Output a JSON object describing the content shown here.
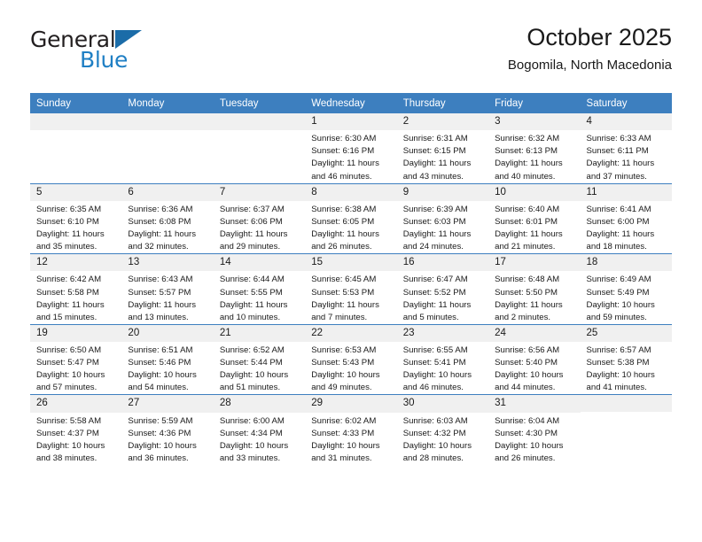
{
  "brand": {
    "name_top": "General",
    "name_bottom": "Blue",
    "accent_color": "#1f7fc4",
    "triangle_color": "#1b6ca8"
  },
  "header": {
    "title": "October 2025",
    "subtitle": "Bogomila, North Macedonia"
  },
  "colors": {
    "header_row": "#3d7fbf",
    "daynum_band": "#f0f0f0",
    "cell_background": "#ffffff",
    "text": "#1a1a1a"
  },
  "weekdays": [
    "Sunday",
    "Monday",
    "Tuesday",
    "Wednesday",
    "Thursday",
    "Friday",
    "Saturday"
  ],
  "weeks": [
    [
      {
        "day": "",
        "sunrise": "",
        "sunset": "",
        "daylight1": "",
        "daylight2": ""
      },
      {
        "day": "",
        "sunrise": "",
        "sunset": "",
        "daylight1": "",
        "daylight2": ""
      },
      {
        "day": "",
        "sunrise": "",
        "sunset": "",
        "daylight1": "",
        "daylight2": ""
      },
      {
        "day": "1",
        "sunrise": "Sunrise: 6:30 AM",
        "sunset": "Sunset: 6:16 PM",
        "daylight1": "Daylight: 11 hours",
        "daylight2": "and 46 minutes."
      },
      {
        "day": "2",
        "sunrise": "Sunrise: 6:31 AM",
        "sunset": "Sunset: 6:15 PM",
        "daylight1": "Daylight: 11 hours",
        "daylight2": "and 43 minutes."
      },
      {
        "day": "3",
        "sunrise": "Sunrise: 6:32 AM",
        "sunset": "Sunset: 6:13 PM",
        "daylight1": "Daylight: 11 hours",
        "daylight2": "and 40 minutes."
      },
      {
        "day": "4",
        "sunrise": "Sunrise: 6:33 AM",
        "sunset": "Sunset: 6:11 PM",
        "daylight1": "Daylight: 11 hours",
        "daylight2": "and 37 minutes."
      }
    ],
    [
      {
        "day": "5",
        "sunrise": "Sunrise: 6:35 AM",
        "sunset": "Sunset: 6:10 PM",
        "daylight1": "Daylight: 11 hours",
        "daylight2": "and 35 minutes."
      },
      {
        "day": "6",
        "sunrise": "Sunrise: 6:36 AM",
        "sunset": "Sunset: 6:08 PM",
        "daylight1": "Daylight: 11 hours",
        "daylight2": "and 32 minutes."
      },
      {
        "day": "7",
        "sunrise": "Sunrise: 6:37 AM",
        "sunset": "Sunset: 6:06 PM",
        "daylight1": "Daylight: 11 hours",
        "daylight2": "and 29 minutes."
      },
      {
        "day": "8",
        "sunrise": "Sunrise: 6:38 AM",
        "sunset": "Sunset: 6:05 PM",
        "daylight1": "Daylight: 11 hours",
        "daylight2": "and 26 minutes."
      },
      {
        "day": "9",
        "sunrise": "Sunrise: 6:39 AM",
        "sunset": "Sunset: 6:03 PM",
        "daylight1": "Daylight: 11 hours",
        "daylight2": "and 24 minutes."
      },
      {
        "day": "10",
        "sunrise": "Sunrise: 6:40 AM",
        "sunset": "Sunset: 6:01 PM",
        "daylight1": "Daylight: 11 hours",
        "daylight2": "and 21 minutes."
      },
      {
        "day": "11",
        "sunrise": "Sunrise: 6:41 AM",
        "sunset": "Sunset: 6:00 PM",
        "daylight1": "Daylight: 11 hours",
        "daylight2": "and 18 minutes."
      }
    ],
    [
      {
        "day": "12",
        "sunrise": "Sunrise: 6:42 AM",
        "sunset": "Sunset: 5:58 PM",
        "daylight1": "Daylight: 11 hours",
        "daylight2": "and 15 minutes."
      },
      {
        "day": "13",
        "sunrise": "Sunrise: 6:43 AM",
        "sunset": "Sunset: 5:57 PM",
        "daylight1": "Daylight: 11 hours",
        "daylight2": "and 13 minutes."
      },
      {
        "day": "14",
        "sunrise": "Sunrise: 6:44 AM",
        "sunset": "Sunset: 5:55 PM",
        "daylight1": "Daylight: 11 hours",
        "daylight2": "and 10 minutes."
      },
      {
        "day": "15",
        "sunrise": "Sunrise: 6:45 AM",
        "sunset": "Sunset: 5:53 PM",
        "daylight1": "Daylight: 11 hours",
        "daylight2": "and 7 minutes."
      },
      {
        "day": "16",
        "sunrise": "Sunrise: 6:47 AM",
        "sunset": "Sunset: 5:52 PM",
        "daylight1": "Daylight: 11 hours",
        "daylight2": "and 5 minutes."
      },
      {
        "day": "17",
        "sunrise": "Sunrise: 6:48 AM",
        "sunset": "Sunset: 5:50 PM",
        "daylight1": "Daylight: 11 hours",
        "daylight2": "and 2 minutes."
      },
      {
        "day": "18",
        "sunrise": "Sunrise: 6:49 AM",
        "sunset": "Sunset: 5:49 PM",
        "daylight1": "Daylight: 10 hours",
        "daylight2": "and 59 minutes."
      }
    ],
    [
      {
        "day": "19",
        "sunrise": "Sunrise: 6:50 AM",
        "sunset": "Sunset: 5:47 PM",
        "daylight1": "Daylight: 10 hours",
        "daylight2": "and 57 minutes."
      },
      {
        "day": "20",
        "sunrise": "Sunrise: 6:51 AM",
        "sunset": "Sunset: 5:46 PM",
        "daylight1": "Daylight: 10 hours",
        "daylight2": "and 54 minutes."
      },
      {
        "day": "21",
        "sunrise": "Sunrise: 6:52 AM",
        "sunset": "Sunset: 5:44 PM",
        "daylight1": "Daylight: 10 hours",
        "daylight2": "and 51 minutes."
      },
      {
        "day": "22",
        "sunrise": "Sunrise: 6:53 AM",
        "sunset": "Sunset: 5:43 PM",
        "daylight1": "Daylight: 10 hours",
        "daylight2": "and 49 minutes."
      },
      {
        "day": "23",
        "sunrise": "Sunrise: 6:55 AM",
        "sunset": "Sunset: 5:41 PM",
        "daylight1": "Daylight: 10 hours",
        "daylight2": "and 46 minutes."
      },
      {
        "day": "24",
        "sunrise": "Sunrise: 6:56 AM",
        "sunset": "Sunset: 5:40 PM",
        "daylight1": "Daylight: 10 hours",
        "daylight2": "and 44 minutes."
      },
      {
        "day": "25",
        "sunrise": "Sunrise: 6:57 AM",
        "sunset": "Sunset: 5:38 PM",
        "daylight1": "Daylight: 10 hours",
        "daylight2": "and 41 minutes."
      }
    ],
    [
      {
        "day": "26",
        "sunrise": "Sunrise: 5:58 AM",
        "sunset": "Sunset: 4:37 PM",
        "daylight1": "Daylight: 10 hours",
        "daylight2": "and 38 minutes."
      },
      {
        "day": "27",
        "sunrise": "Sunrise: 5:59 AM",
        "sunset": "Sunset: 4:36 PM",
        "daylight1": "Daylight: 10 hours",
        "daylight2": "and 36 minutes."
      },
      {
        "day": "28",
        "sunrise": "Sunrise: 6:00 AM",
        "sunset": "Sunset: 4:34 PM",
        "daylight1": "Daylight: 10 hours",
        "daylight2": "and 33 minutes."
      },
      {
        "day": "29",
        "sunrise": "Sunrise: 6:02 AM",
        "sunset": "Sunset: 4:33 PM",
        "daylight1": "Daylight: 10 hours",
        "daylight2": "and 31 minutes."
      },
      {
        "day": "30",
        "sunrise": "Sunrise: 6:03 AM",
        "sunset": "Sunset: 4:32 PM",
        "daylight1": "Daylight: 10 hours",
        "daylight2": "and 28 minutes."
      },
      {
        "day": "31",
        "sunrise": "Sunrise: 6:04 AM",
        "sunset": "Sunset: 4:30 PM",
        "daylight1": "Daylight: 10 hours",
        "daylight2": "and 26 minutes."
      },
      {
        "day": "",
        "sunrise": "",
        "sunset": "",
        "daylight1": "",
        "daylight2": ""
      }
    ]
  ]
}
